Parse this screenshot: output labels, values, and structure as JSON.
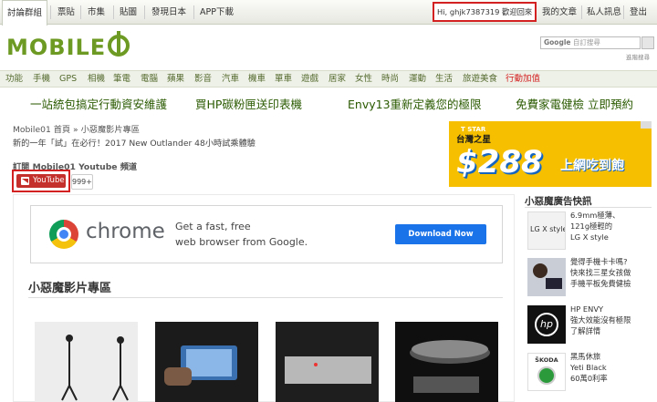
{
  "topnav": {
    "items": [
      "討論群組",
      "票貼",
      "市集",
      "貼圖",
      "發現日本",
      "APP下載"
    ],
    "user_greeting": "Hi, ghjk7387319 歡迎回來",
    "right_items": [
      "我的文章",
      "私人訊息",
      "登出"
    ]
  },
  "brand": {
    "logo_text": "MOBILE"
  },
  "search": {
    "google_label": "Google",
    "placeholder": "自訂搜尋",
    "note": "進階搜尋"
  },
  "categories": [
    "功能",
    "手機",
    "GPS",
    "相機",
    "筆電",
    "電腦",
    "蘋果",
    "影音",
    "汽車",
    "機車",
    "單車",
    "遊戲",
    "居家",
    "女性",
    "時尚",
    "運動",
    "生活",
    "旅遊美食",
    "行動加值"
  ],
  "promos": [
    "一站統包搞定行動資安維護",
    "買HP碳粉匣送印表機",
    "Envy13重新定義您的極限",
    "免費家電健檢 立即預約"
  ],
  "breadcrumb": "Mobile01 首頁 » 小惡魔影片專區",
  "subheadline": "新的一年「試」在必行！2017 New Outlander 48小時試乘體驗",
  "youtube": {
    "label": "訂閱 Mobile01 Youtube 頻道",
    "button": "YouTube",
    "count": "999+"
  },
  "ad": {
    "brand": "chrome",
    "line1": "Get a fast, free",
    "line2": "web browser from Google.",
    "button": "Download Now"
  },
  "video_section_title": "小惡魔影片專區",
  "right_banner": {
    "tstar": "T STAR",
    "sub": "台灣之星",
    "price": "$288",
    "tail": "上網吃到飽"
  },
  "sidebar": {
    "title": "小惡魔廣告快訊",
    "items": [
      {
        "lines": [
          "6.9mm極薄、",
          "121g極輕的",
          "LG X style"
        ],
        "img_label": "LG X style"
      },
      {
        "lines": [
          "覺得手機卡卡嗎?",
          "快來找三星女孩做",
          "手機平板免費健檢"
        ],
        "img_label": ""
      },
      {
        "lines": [
          "HP ENVY",
          "強大效能沒有極限",
          "了解詳情"
        ],
        "img_label": "hp"
      },
      {
        "lines": [
          "黑馬休旅",
          "Yeti Black",
          "60萬0利率"
        ],
        "img_label": "ŠKODA"
      }
    ]
  }
}
